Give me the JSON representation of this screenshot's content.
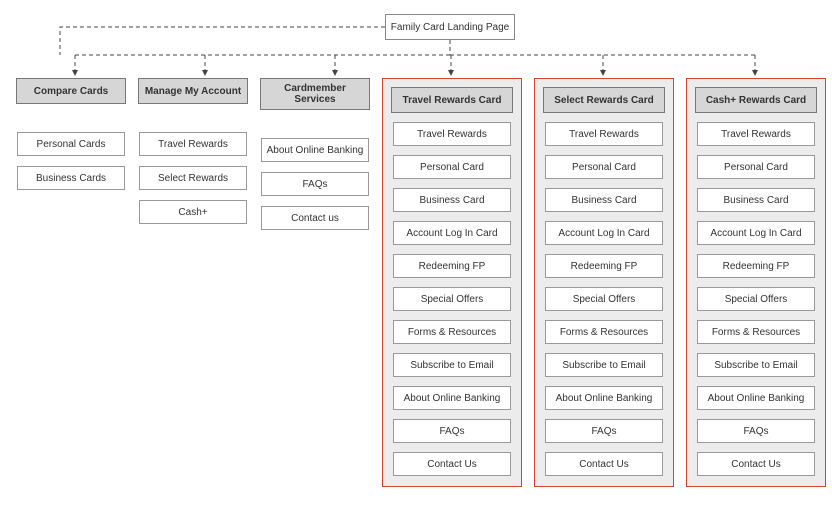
{
  "root": {
    "title": "Family Card Landing Page"
  },
  "columns": [
    {
      "id": "compare-cards",
      "highlighted": false,
      "header": "Compare Cards",
      "items": [
        "Personal Cards",
        "Business Cards"
      ]
    },
    {
      "id": "manage-my-account",
      "highlighted": false,
      "header": "Manage My Account",
      "items": [
        "Travel Rewards",
        "Select Rewards",
        "Cash+"
      ]
    },
    {
      "id": "cardmember-services",
      "highlighted": false,
      "header": "Cardmember Services",
      "items": [
        "About Online Banking",
        "FAQs",
        "Contact us"
      ]
    },
    {
      "id": "travel-rewards-card",
      "highlighted": true,
      "header": "Travel Rewards Card",
      "items": [
        "Travel Rewards",
        "Personal Card",
        "Business Card",
        "Account Log In Card",
        "Redeeming FP",
        "Special Offers",
        "Forms & Resources",
        "Subscribe to Email",
        "About Online Banking",
        "FAQs",
        "Contact Us"
      ]
    },
    {
      "id": "select-rewards-card",
      "highlighted": true,
      "header": "Select Rewards Card",
      "items": [
        "Travel Rewards",
        "Personal Card",
        "Business Card",
        "Account Log In Card",
        "Redeeming FP",
        "Special Offers",
        "Forms & Resources",
        "Subscribe to Email",
        "About Online Banking",
        "FAQs",
        "Contact Us"
      ]
    },
    {
      "id": "cash-plus-rewards-card",
      "highlighted": true,
      "header": "Cash+ Rewards Card",
      "items": [
        "Travel Rewards",
        "Personal Card",
        "Business Card",
        "Account Log In Card",
        "Redeeming FP",
        "Special Offers",
        "Forms & Resources",
        "Subscribe to Email",
        "About Online Banking",
        "FAQs",
        "Contact Us"
      ]
    }
  ]
}
